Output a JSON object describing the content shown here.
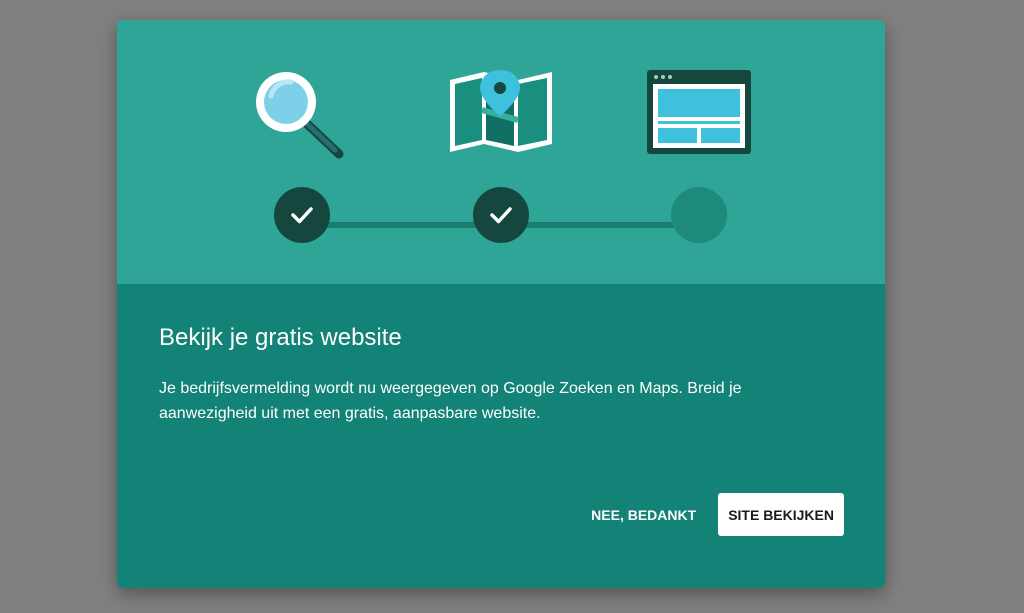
{
  "dialog": {
    "title": "Bekijk je gratis website",
    "description": "Je bedrijfsvermelding wordt nu weergegeven op Google Zoeken en Maps. Breid je aanwezigheid uit met een gratis, aanpasbare website.",
    "buttons": {
      "decline_label": "NEE, BEDANKT",
      "confirm_label": "SITE BEKIJKEN"
    },
    "illustrations": [
      "search-icon",
      "map-pin-icon",
      "website-browser-icon"
    ],
    "steps": [
      {
        "state": "complete"
      },
      {
        "state": "complete"
      },
      {
        "state": "pending"
      }
    ]
  },
  "colors": {
    "backdrop": "#808080",
    "hero": "#2ea597",
    "body": "#138277",
    "step_done": "#16473f",
    "step_pending": "#1d8a7c"
  }
}
